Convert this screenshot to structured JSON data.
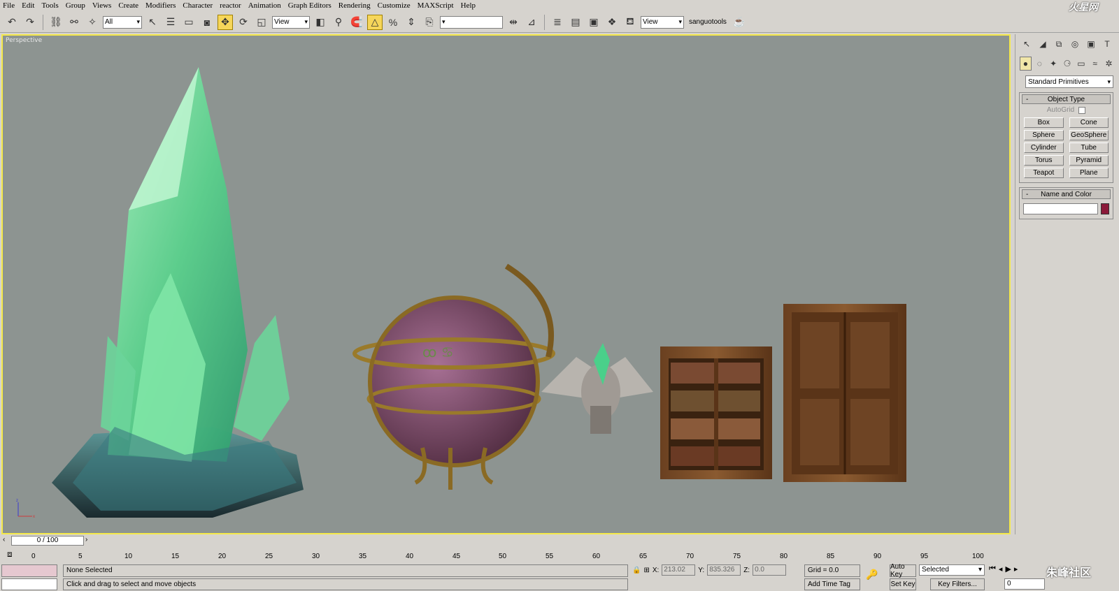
{
  "menu": [
    "File",
    "Edit",
    "Tools",
    "Group",
    "Views",
    "Create",
    "Modifiers",
    "Character",
    "reactor",
    "Animation",
    "Graph Editors",
    "Rendering",
    "Customize",
    "MAXScript",
    "Help"
  ],
  "logo_text": "火星网",
  "toolbar": {
    "filter_value": "All",
    "refcoord_value": "View",
    "named_sel_value": "",
    "view2_value": "View",
    "tools_label": "sanguotools"
  },
  "viewport": {
    "label": "Perspective",
    "axis_z": "z",
    "axis_x": "x"
  },
  "command_panel": {
    "category": "Standard Primitives",
    "object_type_title": "Object Type",
    "autogrid_label": "AutoGrid",
    "buttons": [
      "Box",
      "Cone",
      "Sphere",
      "GeoSphere",
      "Cylinder",
      "Tube",
      "Torus",
      "Pyramid",
      "Teapot",
      "Plane"
    ],
    "name_color_title": "Name and Color",
    "object_color": "#8b1a3a"
  },
  "timeline": {
    "frame_display": "0 / 100",
    "ticks": [
      "0",
      "5",
      "10",
      "15",
      "20",
      "25",
      "30",
      "35",
      "40",
      "45",
      "50",
      "55",
      "60",
      "65",
      "70",
      "75",
      "80",
      "85",
      "90",
      "95",
      "100"
    ]
  },
  "status": {
    "selection": "None Selected",
    "prompt": "Click and drag to select and move objects",
    "x_label": "X:",
    "x_value": "213.02",
    "y_label": "Y:",
    "y_value": "835.326",
    "z_label": "Z:",
    "z_value": "0.0",
    "grid": "Grid = 0.0",
    "time_tag": "Add Time Tag",
    "auto_key": "Auto Key",
    "set_key": "Set Key",
    "selected_value": "Selected",
    "key_filters": "Key Filters...",
    "current_frame": "0"
  },
  "watermark": "朱峰社区"
}
